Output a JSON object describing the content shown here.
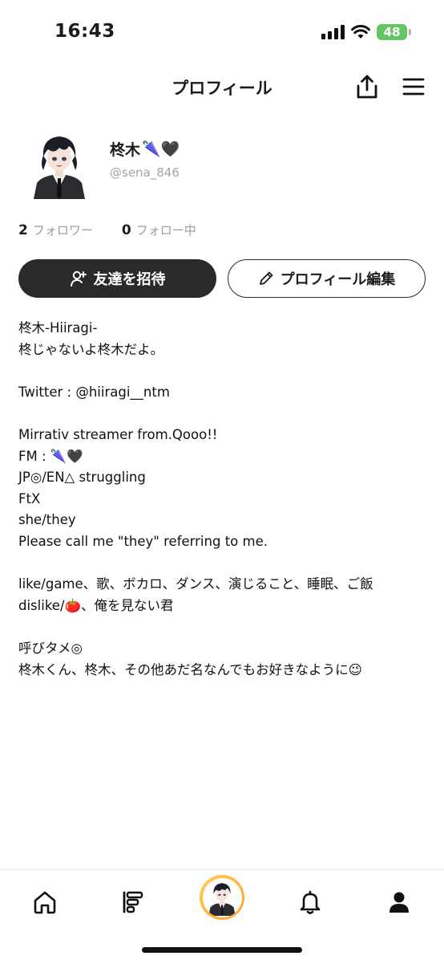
{
  "status_bar": {
    "time": "16:43",
    "battery": "48"
  },
  "header": {
    "title": "プロフィール",
    "share_icon": "share-icon",
    "menu_icon": "hamburger-menu-icon"
  },
  "profile": {
    "name": "柊木",
    "name_emoji": "🌂🖤",
    "handle": "@sena_846",
    "avatar_icon": "avatar-character-icon"
  },
  "stats": {
    "followers_count": "2",
    "followers_label": "フォロワー",
    "following_count": "0",
    "following_label": "フォロー中"
  },
  "actions": {
    "invite_label": "友達を招待",
    "invite_icon": "add-user-icon",
    "edit_label": "プロフィール編集",
    "edit_icon": "pencil-icon"
  },
  "bio": {
    "lines": [
      "柊木-Hiiragi-",
      "柊じゃないよ柊木だよ。",
      "",
      "Twitter : @hiiragi__ntm",
      "",
      "Mirrativ streamer from.Qooo!!",
      "FM : 🌂🖤",
      "JP◎/EN△ struggling",
      "FtX",
      "she/they",
      "Please call me \"they\" referring to me.",
      "",
      "like/game、歌、ボカロ、ダンス、演じること、睡眠、ご飯",
      "dislike/🍅、俺を見ない君",
      "",
      "呼びタメ◎",
      "柊木くん、柊木、その他あだ名なんでもお好きなように😉"
    ]
  },
  "tabbar": {
    "tabs": [
      "home-icon",
      "feed-icon",
      "profile-avatar-tab",
      "bell-icon",
      "person-icon"
    ]
  },
  "colors": {
    "primary_button": "#2a2a2c",
    "muted_text": "#9a9a9f",
    "battery": "#65c466",
    "avatar_ring": "#ffb43a"
  }
}
